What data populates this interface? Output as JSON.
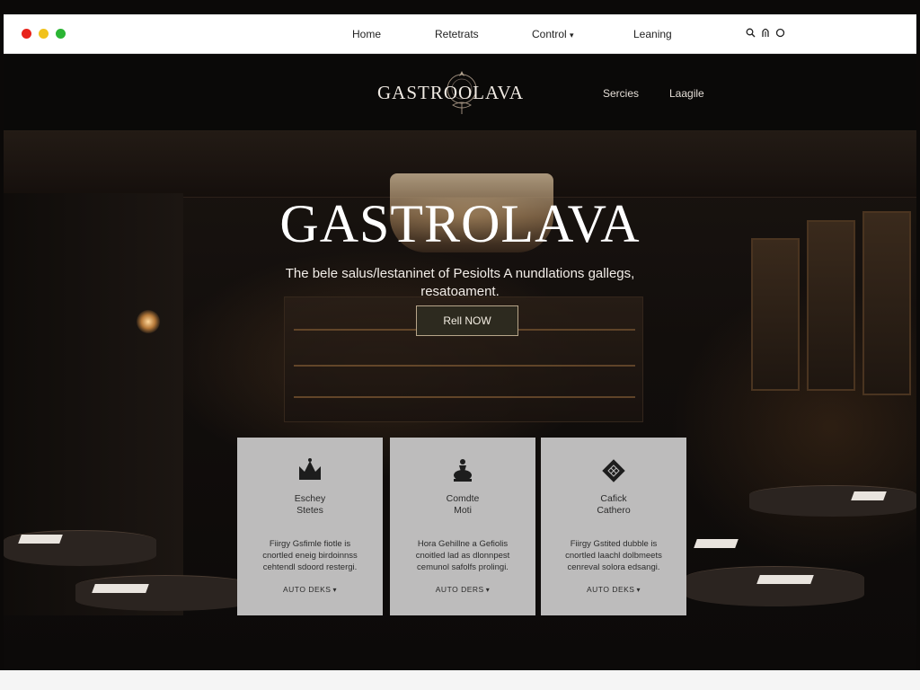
{
  "window": {
    "controls": [
      "close",
      "minimize",
      "maximize"
    ],
    "colors": {
      "close": "#e8231b",
      "minimize": "#f1c21b",
      "maximize": "#2bb534"
    }
  },
  "top_nav": {
    "items": [
      "Home",
      "Retetrats",
      "Control",
      "Leaning"
    ],
    "dropdown_chevron": "▾",
    "icons": [
      "search-icon",
      "user-icon",
      "circle-icon"
    ]
  },
  "site_header": {
    "brand": "GASTROOLAVA",
    "nav": [
      "Sercies",
      "Laagile"
    ]
  },
  "hero": {
    "title": "GASTROLAVA",
    "subtitle_line1": "The bele salus/lestaninet of Pesiolts A nundlations gallegs,",
    "subtitle_line2": "resatoament.",
    "cta": "Rell NOW"
  },
  "cards": [
    {
      "icon": "crown-icon",
      "title": "Eschey\nStetes",
      "desc": "Fiirgy Gsfimle fiotle is\ncnortled eneig birdoinnss\ncehtendl sdoord restergi.",
      "link": "AUTO DEKS"
    },
    {
      "icon": "chess-piece-icon",
      "title": "Comdte\nMoti",
      "desc": "Hora Gehillne a Gefiolis\ncnoitled lad as dlonnpest\ncemunol safolfs prolingi.",
      "link": "AUTO DERS"
    },
    {
      "icon": "diamond-pattern-icon",
      "title": "Cafick\nCathero",
      "desc": "Fiirgy Gstited dubble is\ncnortled laachl dolbmeets\ncenreval solora edsangi.",
      "link": "AUTO DEKS"
    }
  ],
  "colors": {
    "card_bg": "#bdbcbc",
    "cta_border": "#b7a58a",
    "page_dark": "#0b0908"
  }
}
